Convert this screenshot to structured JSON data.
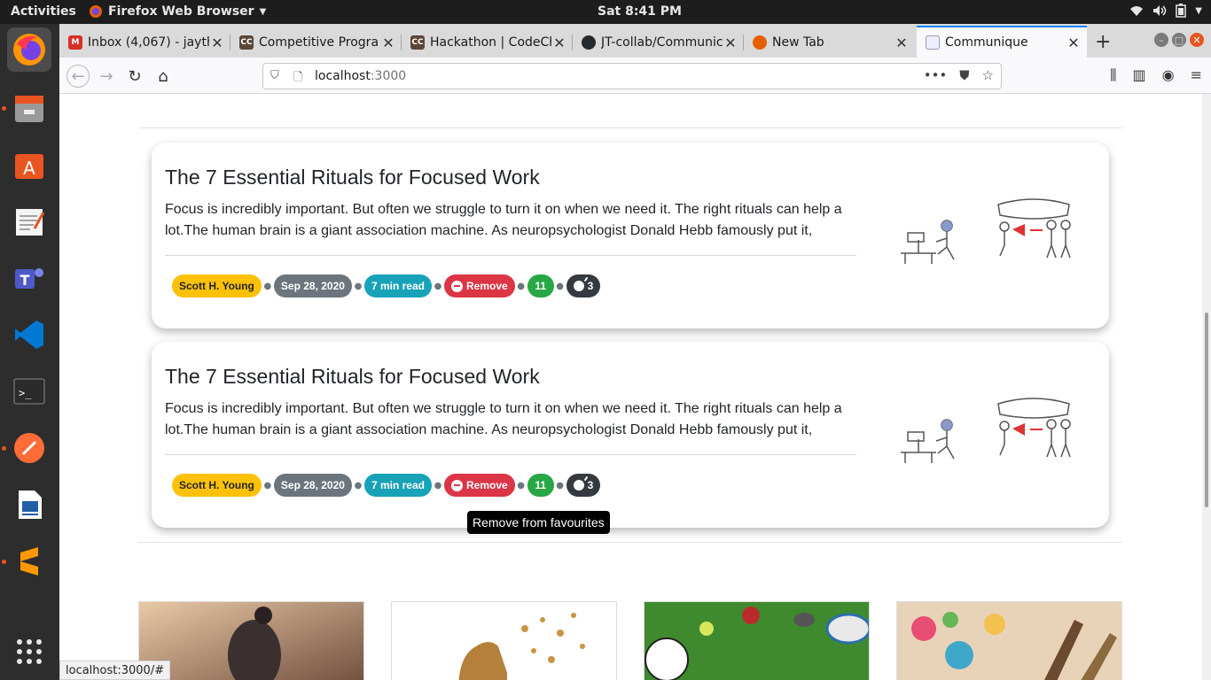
{
  "topbar": {
    "activities": "Activities",
    "app_name": "Firefox Web Browser",
    "clock": "Sat  8:41 PM"
  },
  "dock": {
    "apps": [
      "firefox-icon",
      "files-icon",
      "software-icon",
      "text-editor-icon",
      "teams-icon",
      "vscode-icon",
      "terminal-icon",
      "postman-icon",
      "writer-icon",
      "sublime-icon",
      "app-grid-icon"
    ]
  },
  "tabs": [
    {
      "title": "Inbox (4,067) - jayth",
      "favicon": "M",
      "color": "#d93025"
    },
    {
      "title": "Competitive Progra",
      "favicon": "CC",
      "color": "#5b4638"
    },
    {
      "title": "Hackathon | CodeCh",
      "favicon": "CC",
      "color": "#5b4638"
    },
    {
      "title": "JT-collab/Communic",
      "favicon": "GH",
      "color": "#24292e"
    },
    {
      "title": "New Tab",
      "favicon": "FF",
      "color": "#e66000"
    },
    {
      "title": "Communique",
      "favicon": "C",
      "color": "#4a6fa5"
    }
  ],
  "address": {
    "host": "localhost",
    "port": ":3000"
  },
  "cards": [
    {
      "title": "The 7 Essential Rituals for Focused Work",
      "description": "Focus is incredibly important. But often we struggle to turn it on when we need it. The right rituals can help a lot.The human brain is a giant association machine. As neuropsychologist Donald Hebb famously put it,",
      "author": "Scott H. Young",
      "date": "Sep 28, 2020",
      "read_time": "7 min read",
      "remove_label": "Remove",
      "likes": "11",
      "bombs": "3"
    },
    {
      "title": "The 7 Essential Rituals for Focused Work",
      "description": "Focus is incredibly important. But often we struggle to turn it on when we need it. The right rituals can help a lot.The human brain is a giant association machine. As neuropsychologist Donald Hebb famously put it,",
      "author": "Scott H. Young",
      "date": "Sep 28, 2020",
      "read_time": "7 min read",
      "remove_label": "Remove",
      "likes": "11",
      "bombs": "3"
    }
  ],
  "tooltip": "Remove from favourites",
  "status_url": "localhost:3000/#"
}
